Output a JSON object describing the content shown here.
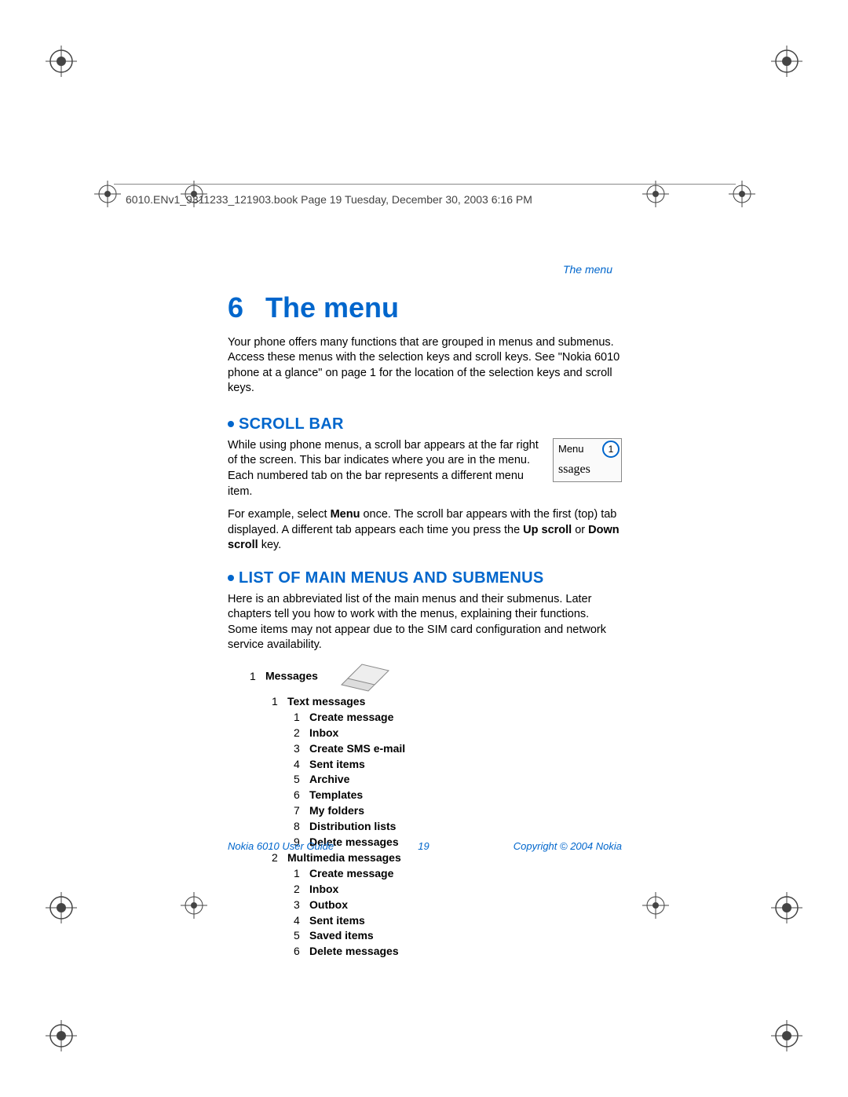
{
  "header": {
    "book_info": "6010.ENv1_9311233_121903.book  Page 19  Tuesday, December 30, 2003  6:16 PM"
  },
  "running_head": "The menu",
  "chapter": {
    "number": "6",
    "title": "The menu",
    "intro": "Your phone offers many functions that are grouped in menus and submenus. Access these menus with the selection keys and scroll keys. See \"Nokia 6010 phone at a glance\" on page 1 for the location of the selection keys and scroll keys."
  },
  "scrollbar_section": {
    "heading": "SCROLL BAR",
    "para1": "While using phone menus, a scroll bar appears at the far right of the screen. This bar indicates where you are in the menu. Each numbered tab on the bar represents a different menu item.",
    "para2_pre": "For example, select ",
    "para2_bold1": "Menu",
    "para2_mid": " once. The scroll bar appears with the first (top) tab displayed. A different tab appears each time you press the ",
    "para2_bold2": "Up scroll",
    "para2_mid2": " or ",
    "para2_bold3": "Down scroll",
    "para2_end": " key.",
    "img_menu": "Menu",
    "img_num": "1",
    "img_ssages": "ssages"
  },
  "list_section": {
    "heading": "LIST OF MAIN MENUS AND SUBMENUS",
    "intro": "Here is an abbreviated list of the main menus and their submenus. Later chapters tell you how to work with the menus, explaining their functions. Some items may not appear due to the SIM card configuration and network service availability."
  },
  "menu": {
    "n1": "1",
    "l1": "Messages",
    "n1_1": "1",
    "l1_1": "Text messages",
    "n1_1_1": "1",
    "l1_1_1": "Create message",
    "n1_1_2": "2",
    "l1_1_2": "Inbox",
    "n1_1_3": "3",
    "l1_1_3": "Create SMS e-mail",
    "n1_1_4": "4",
    "l1_1_4": "Sent items",
    "n1_1_5": "5",
    "l1_1_5": "Archive",
    "n1_1_6": "6",
    "l1_1_6": "Templates",
    "n1_1_7": "7",
    "l1_1_7": "My folders",
    "n1_1_8": "8",
    "l1_1_8": "Distribution lists",
    "n1_1_9": "9",
    "l1_1_9": "Delete messages",
    "n1_2": "2",
    "l1_2": "Multimedia messages",
    "n1_2_1": "1",
    "l1_2_1": "Create message",
    "n1_2_2": "2",
    "l1_2_2": "Inbox",
    "n1_2_3": "3",
    "l1_2_3": "Outbox",
    "n1_2_4": "4",
    "l1_2_4": "Sent items",
    "n1_2_5": "5",
    "l1_2_5": "Saved items",
    "n1_2_6": "6",
    "l1_2_6": "Delete messages"
  },
  "footer": {
    "left": "Nokia 6010 User Guide",
    "center": "19",
    "right": "Copyright © 2004 Nokia"
  }
}
